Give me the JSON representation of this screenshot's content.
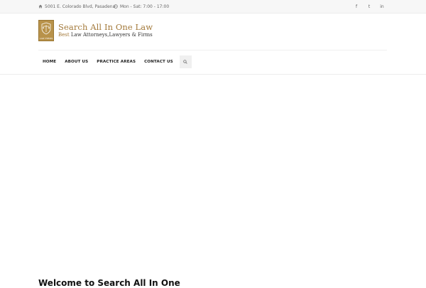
{
  "topbar": {
    "address": "5001 E. Colorado Blvd, Pasadena",
    "hours": "Mon - Sat: 7:00 - 17:00",
    "social": [
      {
        "icon": "facebook-icon",
        "glyph": "f"
      },
      {
        "icon": "twitter-icon",
        "glyph": "t"
      },
      {
        "icon": "linkedin-icon",
        "glyph": "in"
      }
    ]
  },
  "logo": {
    "line1": "Search All In One Law",
    "line2_prefix": "Best ",
    "line2_rest": "Law Attorneys,Lawyers & Firms",
    "emblem_caption": "LAW FIRMS"
  },
  "nav": {
    "items": [
      "HOME",
      "ABOUT US",
      "PRACTICE AREAS",
      "CONTACT US"
    ],
    "search_icon": "search-icon"
  },
  "main": {
    "welcome_heading": "Welcome to Search All In One"
  },
  "colors": {
    "brand_gold": "#a3793a",
    "topbar_bg": "#f7f7f7"
  }
}
